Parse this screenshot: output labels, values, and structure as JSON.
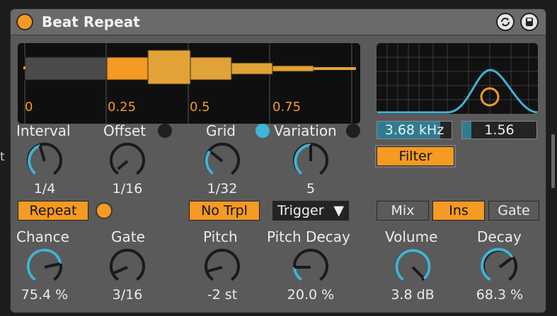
{
  "edge_text": "t",
  "device": {
    "title": "Beat Repeat",
    "colors": {
      "accent": "#f59a23",
      "blue": "#3fb3d8",
      "panel": "#5a5a5a"
    }
  },
  "timeline": {
    "ticks": [
      "0",
      "0.25",
      "0.5",
      "0.75"
    ]
  },
  "filter": {
    "freq": "3.68 kHz",
    "q": "1.56",
    "button": "Filter"
  },
  "knobs": {
    "interval": {
      "label": "Interval",
      "value": "1/4"
    },
    "offset": {
      "label": "Offset",
      "value": "1/16"
    },
    "grid": {
      "label": "Grid",
      "value": "1/32"
    },
    "variation": {
      "label": "Variation",
      "value": "5"
    },
    "chance": {
      "label": "Chance",
      "value": "75.4 %"
    },
    "gate": {
      "label": "Gate",
      "value": "3/16"
    },
    "pitch": {
      "label": "Pitch",
      "value": "-2 st"
    },
    "pitch_decay": {
      "label": "Pitch Decay",
      "value": "20.0 %"
    },
    "volume": {
      "label": "Volume",
      "value": "3.8 dB"
    },
    "decay": {
      "label": "Decay",
      "value": "68.3 %"
    }
  },
  "buttons": {
    "repeat": "Repeat",
    "no_trpl": "No Trpl",
    "trigger": "Trigger",
    "mix": "Mix",
    "ins": "Ins",
    "gate": "Gate"
  }
}
